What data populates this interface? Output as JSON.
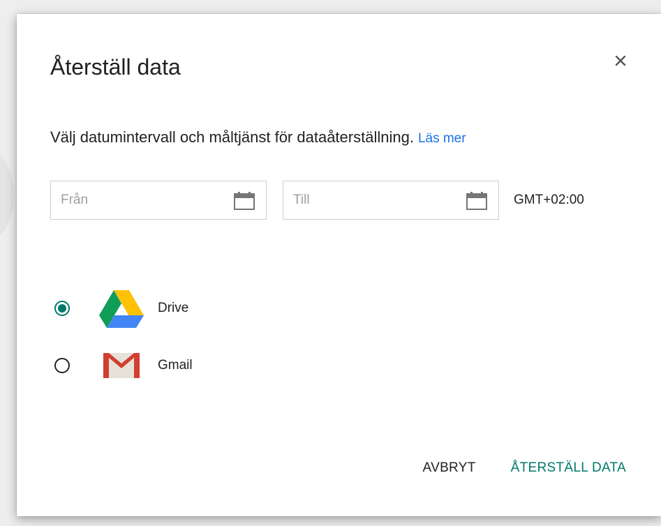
{
  "dialog": {
    "title": "Återställ data",
    "description": "Välj datumintervall och måltjänst för dataåterställning.",
    "learn_more": "Läs mer",
    "from_placeholder": "Från",
    "to_placeholder": "Till",
    "timezone": "GMT+02:00",
    "services": [
      {
        "label": "Drive",
        "selected": true,
        "icon": "google-drive-icon"
      },
      {
        "label": "Gmail",
        "selected": false,
        "icon": "gmail-icon"
      }
    ],
    "cancel_label": "AVBRYT",
    "confirm_label": "ÅTERSTÄLL DATA"
  },
  "colors": {
    "accent": "#00796b",
    "link": "#1a73e8",
    "text": "#212121",
    "placeholder": "#9e9e9e"
  }
}
